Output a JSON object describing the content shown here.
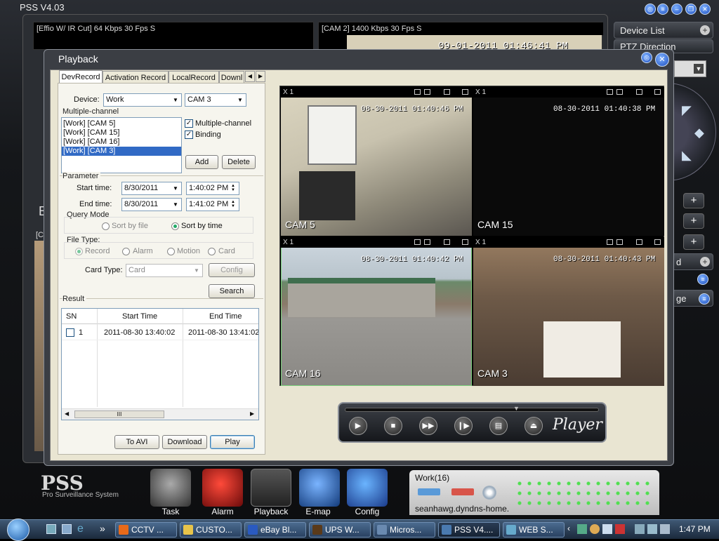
{
  "app": {
    "title": "PSS  V4.03",
    "logo": "PSS",
    "logo_sub": "Pro Surveillance System"
  },
  "live": {
    "cam1_header": "[Effio W/ IR Cut]  64 Kbps 30 Fps S",
    "cam2_header": "[CAM 2]  1400 Kbps 30 Fps S",
    "cam2_timestamp": "09-01-2011  01:46:41 PM",
    "side_letter": "E",
    "side_letter2": "[C"
  },
  "right_panel": {
    "device_list": "Device List",
    "ptz": "PTZ Direction",
    "partial_d": "d",
    "partial_ge": "ge"
  },
  "playback": {
    "title": "Playback",
    "tabs": [
      "DevRecord",
      "Activation Record",
      "LocalRecord",
      "Downl"
    ],
    "device_label": "Device:",
    "device_value": "Work",
    "camera_value": "CAM 3",
    "multichannel_group": "Multiple-channel",
    "channels": [
      "[Work] [CAM 5]",
      "[Work] [CAM 15]",
      "[Work] [CAM 16]",
      "[Work] [CAM 3]"
    ],
    "multichannel_check": "Multiple-channel",
    "binding_check": "Binding",
    "add": "Add",
    "delete": "Delete",
    "parameter_group": "Parameter",
    "start_label": "Start time:",
    "start_date": "8/30/2011",
    "start_time": "1:40:02 PM",
    "end_label": "End time:",
    "end_date": "8/30/2011",
    "end_time": "1:41:02 PM",
    "query_mode": "Query Mode",
    "sort_file": "Sort by file",
    "sort_time": "Sort by time",
    "file_type": "File Type:",
    "ft_record": "Record",
    "ft_alarm": "Alarm",
    "ft_motion": "Motion",
    "ft_card": "Card",
    "card_type_label": "Card Type:",
    "card_type_value": "Card",
    "config": "Config",
    "search": "Search",
    "result_group": "Result",
    "col_sn": "SN",
    "col_start": "Start Time",
    "col_end": "End Time",
    "row_sn": "1",
    "row_start": "2011-08-30 13:40:02",
    "row_end": "2011-08-30 13:41:02",
    "scroll_grip": "III",
    "to_avi": "To AVI",
    "download": "Download",
    "play": "Play"
  },
  "video": {
    "zoom": "X 1",
    "cells": [
      {
        "ts": "08-30-2011  01:40:46 PM",
        "label": "CAM 5"
      },
      {
        "ts": "08-30-2011  01:40:38 PM",
        "label": "CAM 15"
      },
      {
        "ts": "08-30-2011  01:40:42 PM",
        "label": "CAM 16"
      },
      {
        "ts": "08-30-2011  01:40:43 PM",
        "label": "CAM 3"
      }
    ]
  },
  "player": {
    "brand": "Player"
  },
  "dock": {
    "task": "Task",
    "alarm": "Alarm",
    "playback": "Playback",
    "emap": "E-map",
    "config": "Config",
    "work": "Work(16)",
    "host": "seanhawg.dyndns-home."
  },
  "taskbar": {
    "items": [
      "CCTV ...",
      "CUSTO...",
      "eBay Bl...",
      "UPS W...",
      "Micros...",
      "PSS V4....",
      "WEB S..."
    ],
    "clock": "1:47 PM",
    "more": "»"
  },
  "colors": {
    "accent_blue": "#316ac5",
    "active_green": "#7ad07a"
  }
}
